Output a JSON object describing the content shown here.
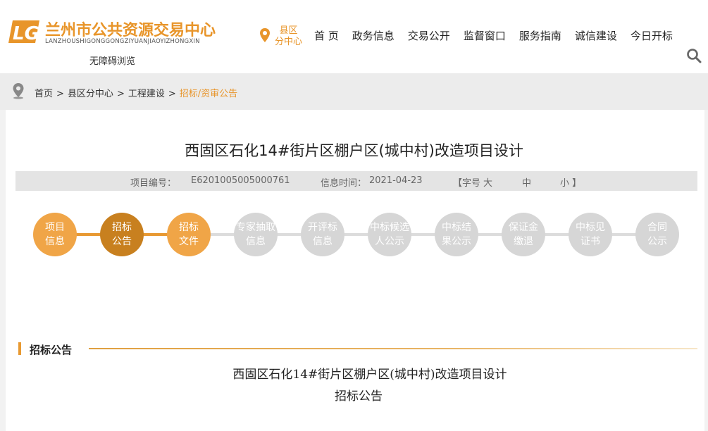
{
  "header": {
    "logo_cn": "兰州市公共资源交易中心",
    "logo_en": "LANZHOUSHIGONGGONGZIYUANJIAOYIZHONGXIN",
    "accessibility": "无障碍浏览",
    "region_line1": "县区",
    "region_line2": "分中心",
    "nav": [
      "首 页",
      "政务信息",
      "交易公开",
      "监督窗口",
      "服务指南",
      "诚信建设",
      "今日开标"
    ],
    "brand_color": "#e8952a",
    "icons": [
      "logo-mark",
      "location-pin-icon",
      "search-icon"
    ]
  },
  "breadcrumb": {
    "items": [
      "首页",
      "县区分中心",
      "工程建设"
    ],
    "current": "招标/资审公告",
    "separator": ">"
  },
  "project": {
    "title": "西固区石化14#街片区棚户区(城中村)改造项目设计",
    "code_label": "项目编号：",
    "code_value": "E6201005005000761",
    "time_label": "信息时间：",
    "time_value": "2021-04-23",
    "font_label": "【字号",
    "font_large": "大",
    "font_medium": "中",
    "font_small": "小 】"
  },
  "steps": [
    {
      "line1": "项目",
      "line2": "信息",
      "state": "done"
    },
    {
      "line1": "招标",
      "line2": "公告",
      "state": "active"
    },
    {
      "line1": "招标",
      "line2": "文件",
      "state": "done"
    },
    {
      "line1": "专家抽取",
      "line2": "信息",
      "state": "todo"
    },
    {
      "line1": "开评标",
      "line2": "信息",
      "state": "todo"
    },
    {
      "line1": "中标候选",
      "line2": "人公示",
      "state": "todo"
    },
    {
      "line1": "中标结",
      "line2": "果公示",
      "state": "todo"
    },
    {
      "line1": "保证金",
      "line2": "缴退",
      "state": "todo"
    },
    {
      "line1": "中标见",
      "line2": "证书",
      "state": "todo"
    },
    {
      "line1": "合同",
      "line2": "公示",
      "state": "todo"
    }
  ],
  "section": {
    "label": "招标公告",
    "doc_title": "西固区石化14#街片区棚户区(城中村)改造项目设计",
    "doc_sub": "招标公告"
  }
}
